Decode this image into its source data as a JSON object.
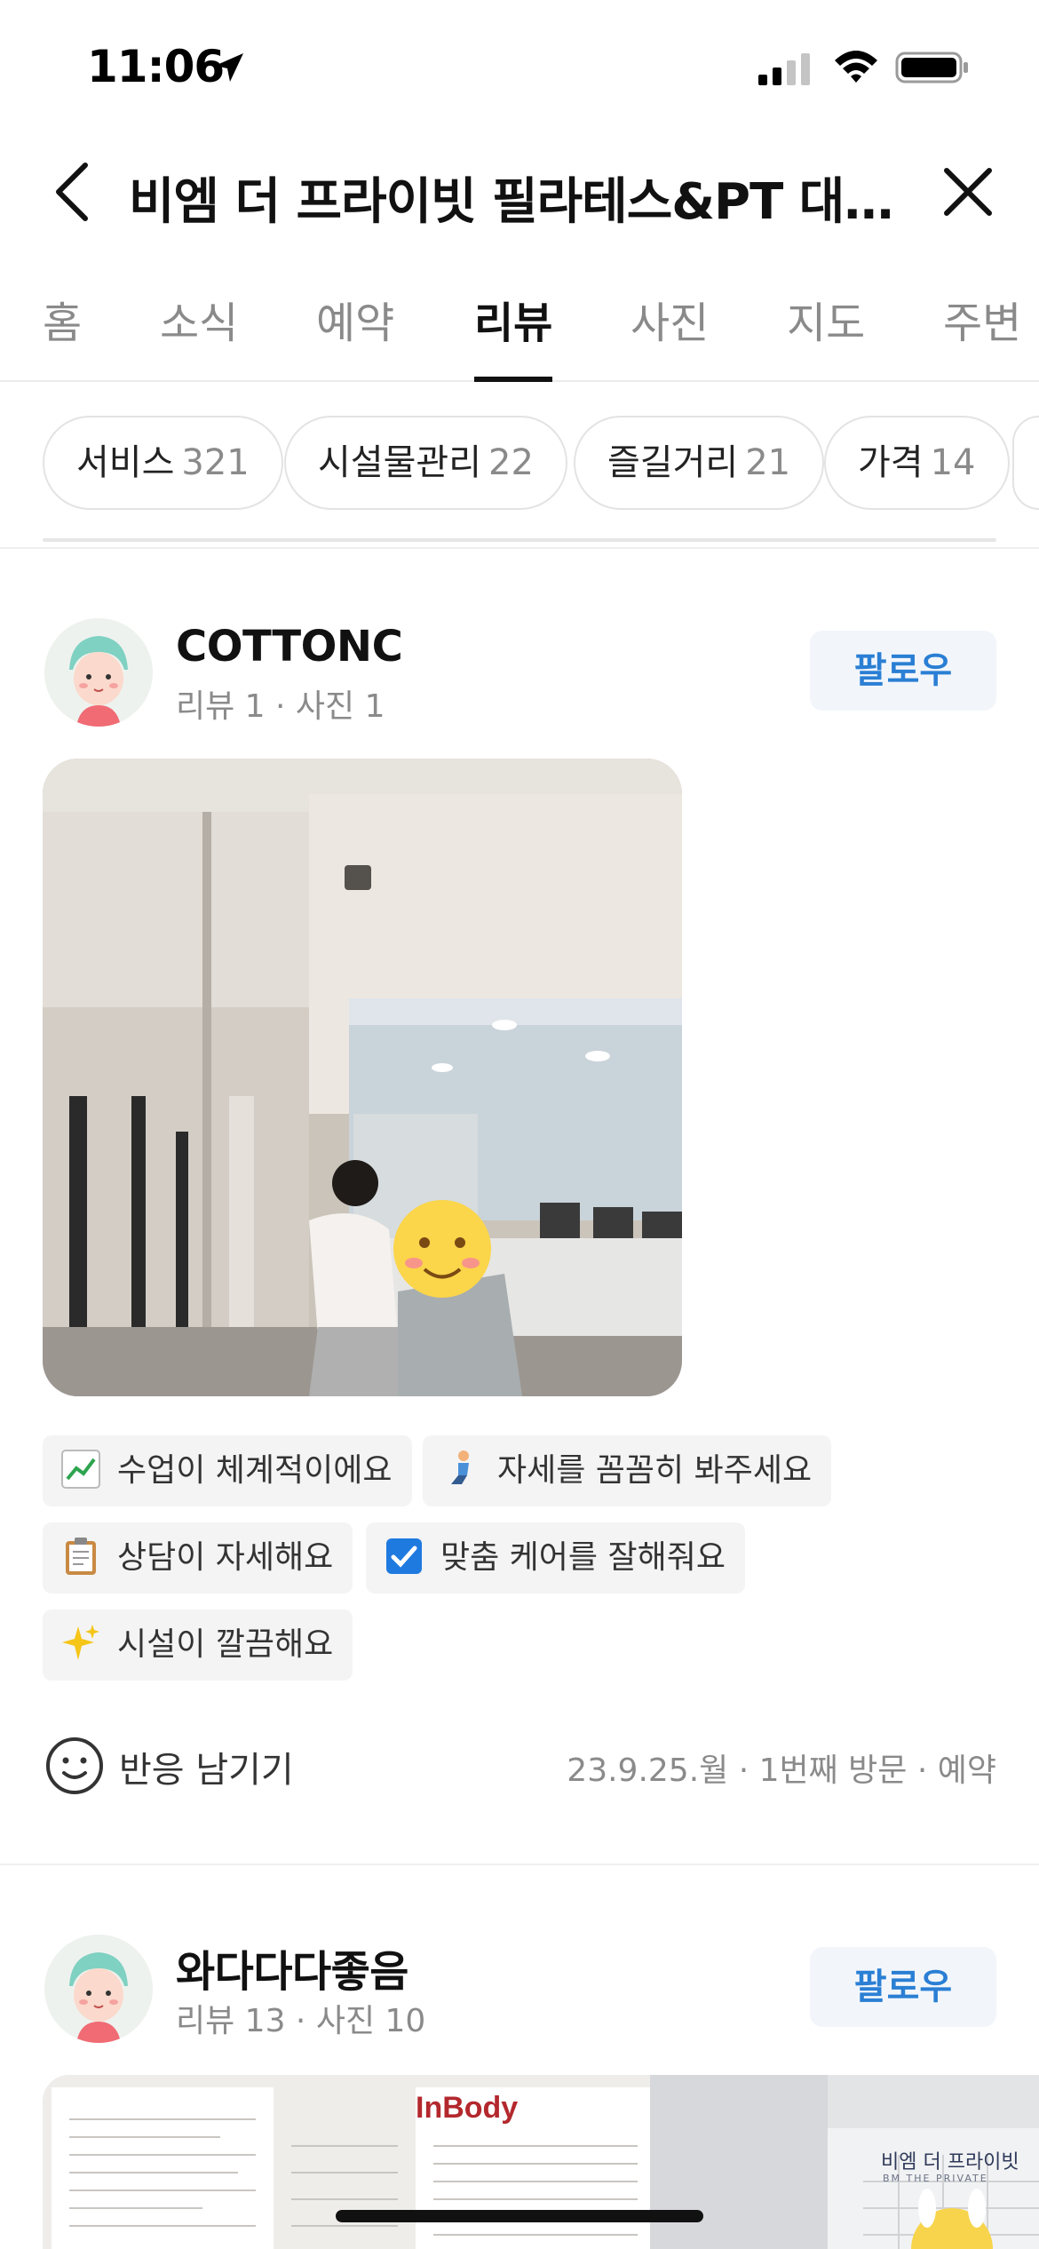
{
  "status_bar": {
    "time": "11:06",
    "icons": [
      "location-arrow-icon",
      "cellular-signal-icon",
      "wifi-icon",
      "battery-icon"
    ]
  },
  "header": {
    "title": "비엠 더 프라이빗 필라테스&PT 대전...",
    "back_icon": "chevron-left-icon",
    "close_icon": "close-icon"
  },
  "tabs": [
    {
      "label": "홈",
      "active": false
    },
    {
      "label": "소식",
      "active": false
    },
    {
      "label": "예약",
      "active": false
    },
    {
      "label": "리뷰",
      "active": true
    },
    {
      "label": "사진",
      "active": false
    },
    {
      "label": "지도",
      "active": false
    },
    {
      "label": "주변",
      "active": false
    }
  ],
  "keyword_chips": [
    {
      "label": "서비스",
      "count": "321"
    },
    {
      "label": "시설물관리",
      "count": "22"
    },
    {
      "label": "즐길거리",
      "count": "21"
    },
    {
      "label": "가격",
      "count": "14"
    }
  ],
  "reviews": [
    {
      "name": "COTTONC",
      "meta": "리뷰 1 · 사진 1",
      "follow_label": "팔로우",
      "tags": [
        {
          "emoji": "chart-increasing-icon",
          "label": "수업이 체계적이에요"
        },
        {
          "emoji": "kneeling-person-icon",
          "label": "자세를 꼼꼼히 봐주세요"
        },
        {
          "emoji": "clipboard-icon",
          "label": "상담이 자세해요"
        },
        {
          "emoji": "check-box-icon",
          "label": "맞춤 케어를 잘해줘요"
        },
        {
          "emoji": "sparkles-icon",
          "label": "시설이 깔끔해요"
        }
      ],
      "reaction_label": "반응 남기기",
      "visit_info": "23.9.25.월 · 1번째 방문 · 예약"
    },
    {
      "name": "와다다다좋음",
      "meta": "리뷰 13 · 사진 10",
      "follow_label": "팔로우",
      "photo_texts": {
        "inbody_logo": "InBody",
        "gym_sign": "비엠 더 프라이빗",
        "gym_sign_sub": "BM THE PRIVATE"
      }
    }
  ],
  "colors": {
    "follow_text": "#2a7fd4",
    "follow_bg": "#f2f6fb",
    "muted_text": "#8a8a8a",
    "tag_bg": "#f4f4f4"
  }
}
